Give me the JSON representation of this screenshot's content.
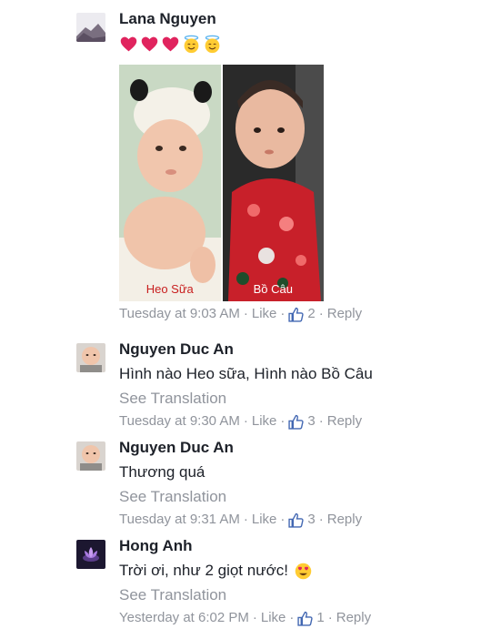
{
  "comments": [
    {
      "author": "Lana Nguyen",
      "reaction_icons": [
        "heart-icon",
        "heart-icon",
        "heart-icon",
        "smiling-face-with-halo-icon",
        "smiling-face-with-halo-icon"
      ],
      "photos": [
        {
          "caption": "Heo Sữa"
        },
        {
          "caption": "Bồ Câu"
        }
      ],
      "time": "Tuesday at 9:03 AM",
      "like_label": "Like",
      "like_count": "2",
      "reply_label": "Reply"
    },
    {
      "author": "Nguyen Duc An",
      "text": "Hình nào Heo sữa, Hình nào Bồ Câu",
      "see_translation": "See Translation",
      "time": "Tuesday at 9:30 AM",
      "like_label": "Like",
      "like_count": "3",
      "reply_label": "Reply"
    },
    {
      "author": "Nguyen Duc An",
      "text": "Thương quá",
      "see_translation": "See Translation",
      "time": "Tuesday at 9:31 AM",
      "like_label": "Like",
      "like_count": "3",
      "reply_label": "Reply"
    },
    {
      "author": "Hong Anh",
      "text": "Trời ơi, như 2 giọt nước!",
      "text_emoji": "heart-eyes-icon",
      "see_translation": "See Translation",
      "time": "Yesterday at 6:02 PM",
      "like_label": "Like",
      "like_count": "1",
      "reply_label": "Reply"
    }
  ],
  "colors": {
    "text": "#1d2129",
    "meta": "#90949c",
    "link_blue": "#4267b2"
  }
}
